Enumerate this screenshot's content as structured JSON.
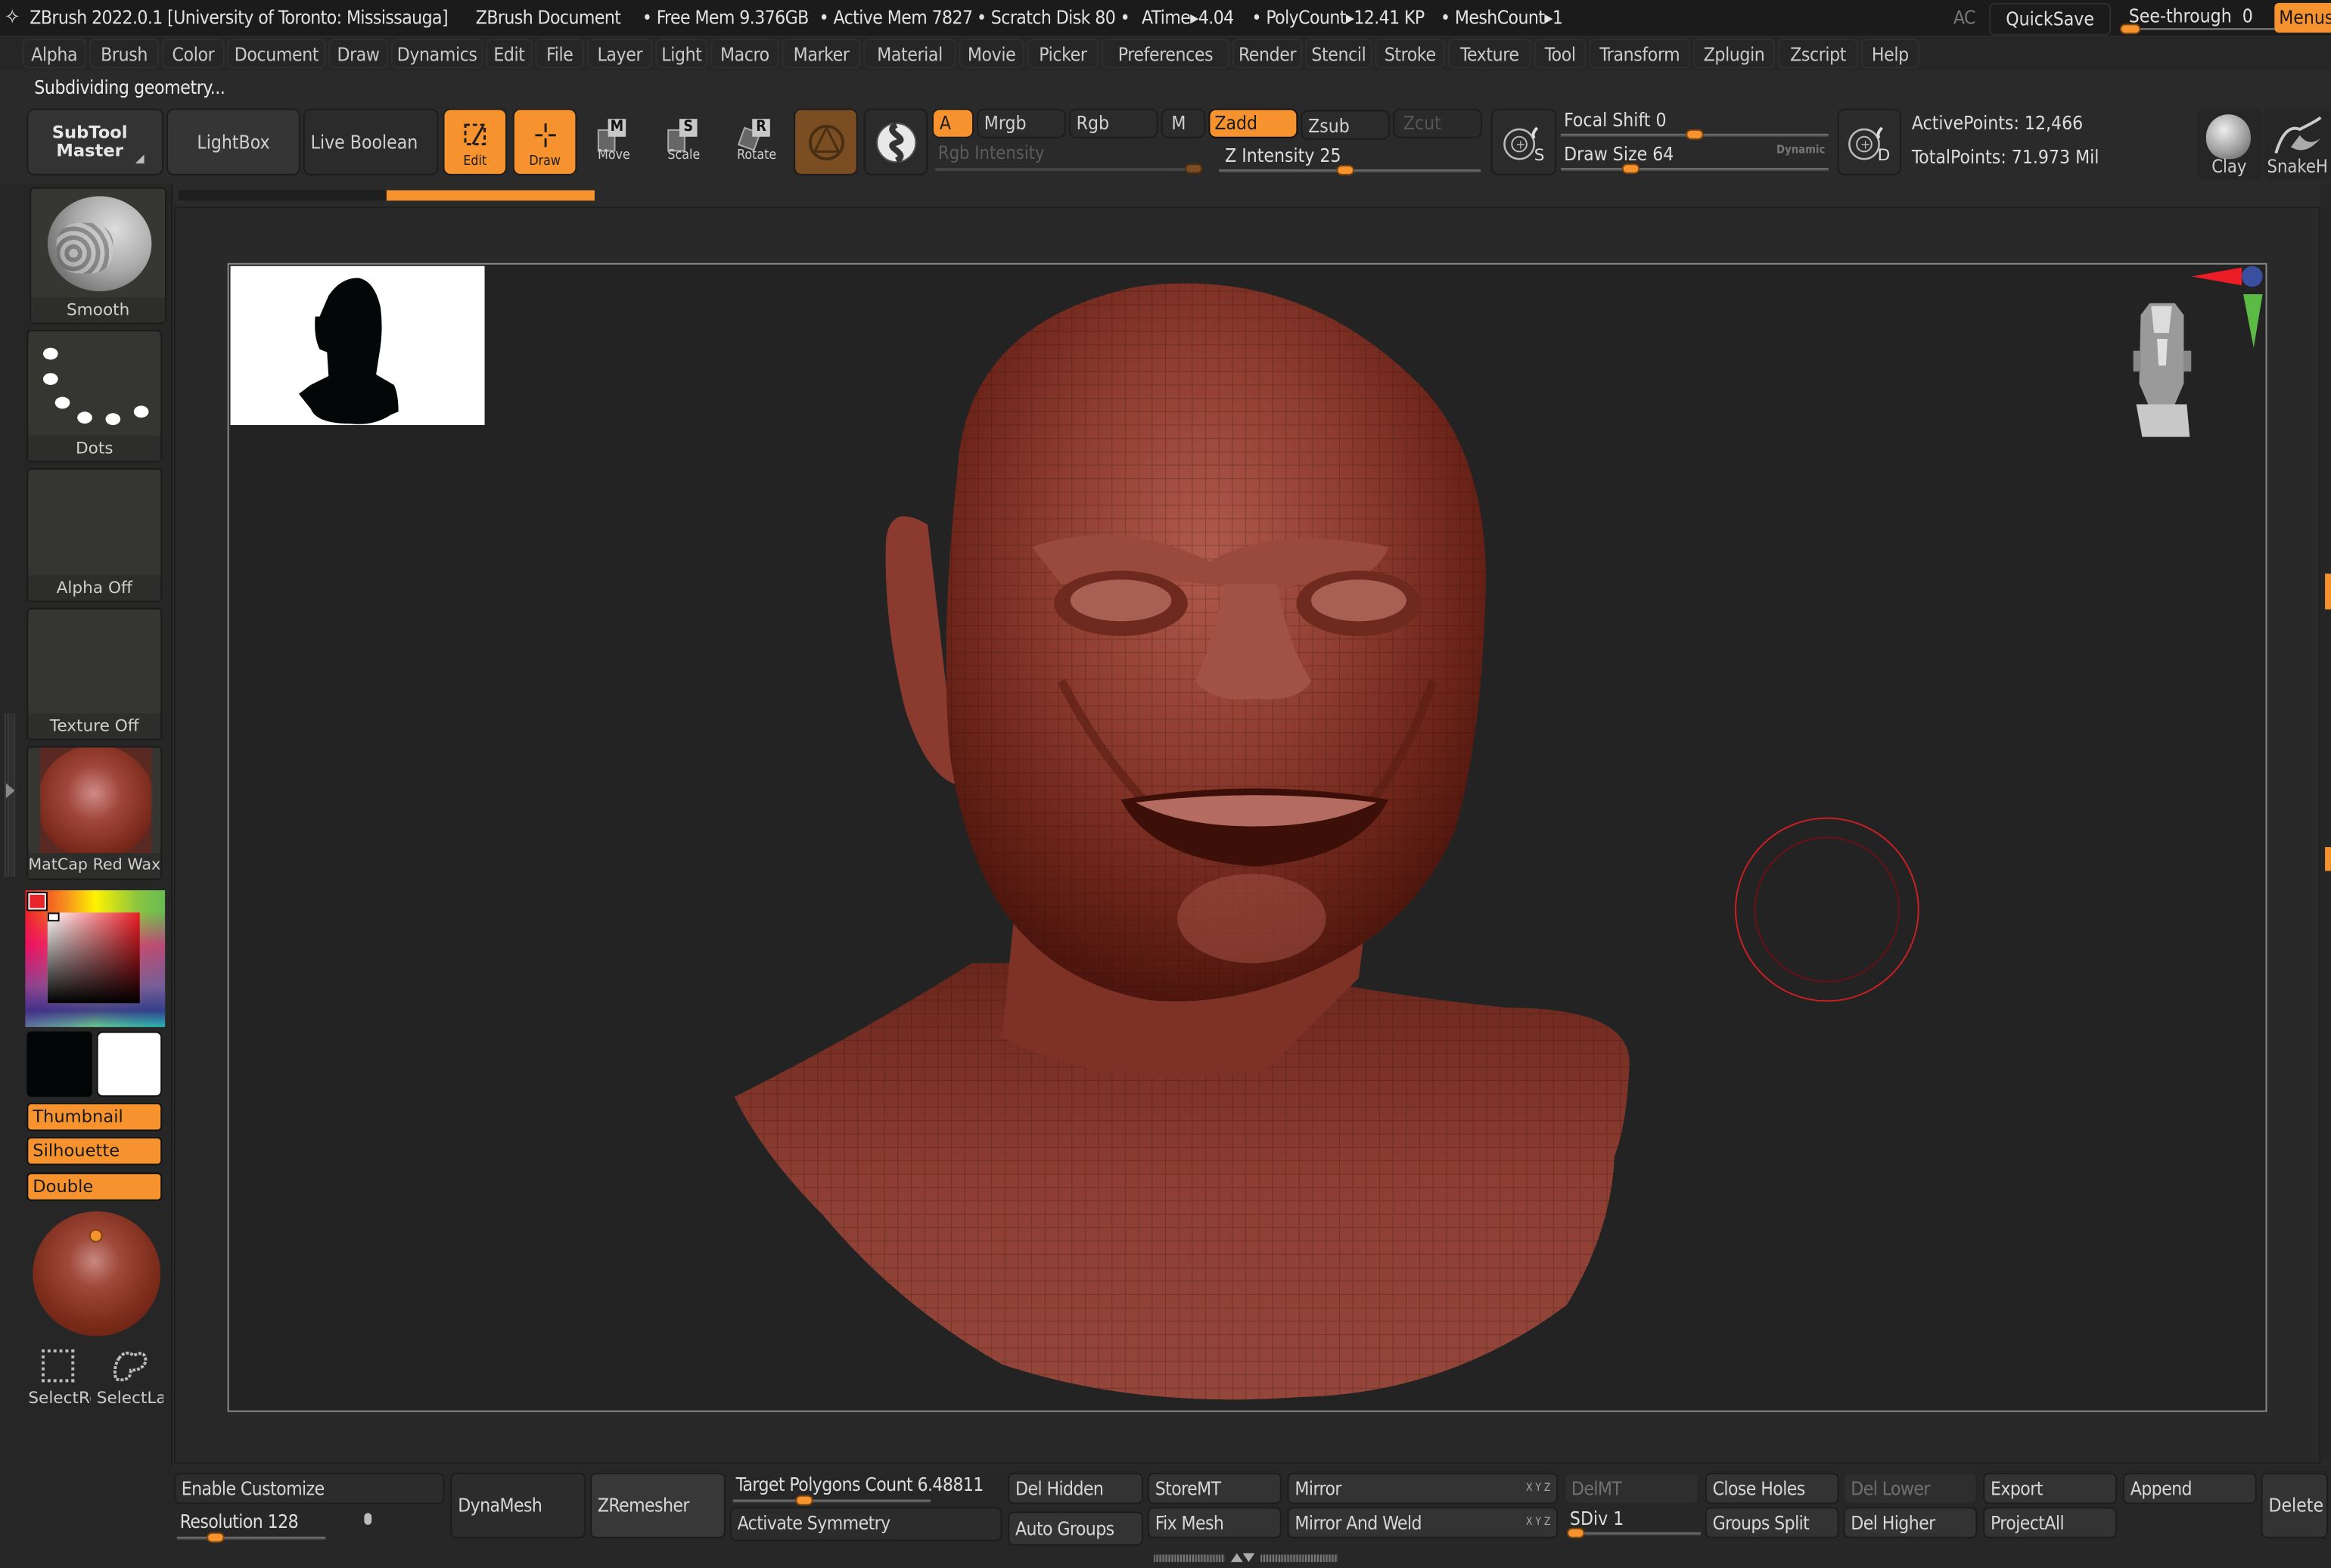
{
  "titlebar": {
    "app_title": "ZBrush 2022.0.1 [University of Toronto: Mississauga]",
    "document": "ZBrush Document",
    "free_mem": "• Free Mem 9.376GB",
    "active_mem": "• Active Mem 7827",
    "scratch_disk": "• Scratch Disk 80 •",
    "atime": "ATime▸4.04",
    "polycount": "• PolyCount▸12.41 KP",
    "meshcount": "• MeshCount▸1",
    "ac": "AC",
    "quicksave": "QuickSave",
    "see_through_label": "See-through",
    "see_through_value": "0",
    "menus": "Menus"
  },
  "menubar": [
    "Alpha",
    "Brush",
    "Color",
    "Document",
    "Draw",
    "Dynamics",
    "Edit",
    "File",
    "Layer",
    "Light",
    "Macro",
    "Marker",
    "Material",
    "Movie",
    "Picker",
    "Preferences",
    "Render",
    "Stencil",
    "Stroke",
    "Texture",
    "Tool",
    "Transform",
    "Zplugin",
    "Zscript",
    "Help"
  ],
  "status": "Subdividing geometry...",
  "toolbar": {
    "subtool_master_line1": "SubTool",
    "subtool_master_line2": "Master",
    "lightbox": "LightBox",
    "live_boolean": "Live Boolean",
    "edit": "Edit",
    "draw": "Draw",
    "move": "Move",
    "scale": "Scale",
    "rotate": "Rotate",
    "move_key": "M",
    "scale_key": "S",
    "rotate_key": "R",
    "a": "A",
    "mrgb": "Mrgb",
    "rgb": "Rgb",
    "m": "M",
    "zadd": "Zadd",
    "zsub": "Zsub",
    "zcut": "Zcut",
    "rgb_intensity": "Rgb Intensity",
    "z_intensity_label": "Z Intensity",
    "z_intensity": "25",
    "focal_shift_label": "Focal Shift",
    "focal_shift": "0",
    "draw_size_label": "Draw Size",
    "draw_size": "64",
    "dynamic": "Dynamic",
    "s_key": "S",
    "d_key": "D",
    "active_points": "ActivePoints: 12,466",
    "total_points": "TotalPoints: 71.973 Mil",
    "clay": "Clay",
    "snakehook": "SnakeH"
  },
  "progress": {
    "value_fraction": 0.5
  },
  "sidebar": {
    "brush": "Smooth",
    "stroke": "Dots",
    "alpha": "Alpha Off",
    "texture": "Texture Off",
    "material": "MatCap Red Wax",
    "thumbnail": "Thumbnail",
    "silhouette": "Silhouette",
    "double": "Double",
    "select_rect": "SelectRect",
    "select_lasso": "SelectLasso",
    "main_color": "#ffffff",
    "secondary_color": "#000000"
  },
  "bottom": {
    "enable_customize": "Enable Customize",
    "resolution_label": "Resolution",
    "resolution": "128",
    "dynamesh": "DynaMesh",
    "zremesher": "ZRemesher",
    "target_polygons_label": "Target Polygons Count",
    "target_polygons": "6.48811",
    "activate_symmetry": "Activate Symmetry",
    "del_hidden": "Del Hidden",
    "auto_groups": "Auto Groups",
    "storemt": "StoreMT",
    "fix_mesh": "Fix Mesh",
    "mirror": "Mirror",
    "mirror_and_weld": "Mirror And Weld",
    "axis_tag": "X Y Z",
    "delmt": "DelMT",
    "sdiv_label": "SDiv",
    "sdiv": "1",
    "close_holes": "Close Holes",
    "groups_split": "Groups Split",
    "del_lower": "Del Lower",
    "del_higher": "Del Higher",
    "export": "Export",
    "projectall": "ProjectAll",
    "append": "Append",
    "delete": "Delete"
  },
  "colors": {
    "accent": "#f7932e",
    "background": "#2a2a2a",
    "model": "#8e3b2f",
    "brush_cursor": "#cc1f24"
  }
}
